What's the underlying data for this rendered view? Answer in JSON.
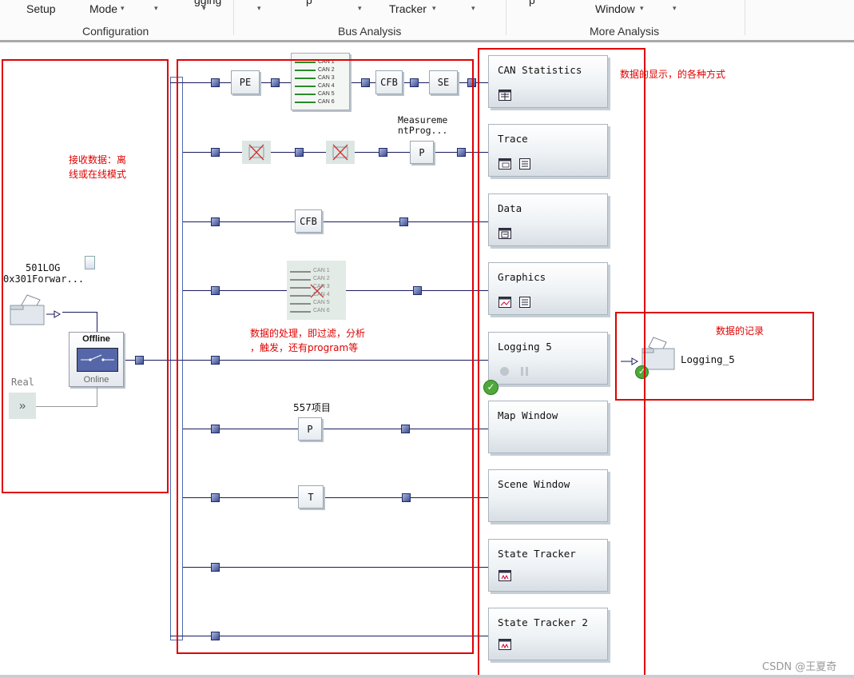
{
  "ribbon": {
    "items": [
      "Setup",
      "Mode",
      "Tracker",
      "Window"
    ],
    "groups": [
      "Configuration",
      "Bus Analysis",
      "More Analysis"
    ]
  },
  "annotations": {
    "receive": [
      "接收数据：离",
      "线或在线模式"
    ],
    "display": "数据的显示，的各种方式",
    "process": [
      "数据的处理，即过滤，分析",
      "，触发，还有program等"
    ],
    "logging": "数据的记录"
  },
  "source": {
    "log_name": "501LOG",
    "log_file": "0x301Forwar...",
    "offline": "Offline",
    "online": "Online",
    "real": "Real"
  },
  "processing": {
    "pe": "PE",
    "cfb": "CFB",
    "se": "SE",
    "p": "P",
    "t": "T",
    "measurement": [
      "Measureme",
      "ntProg..."
    ],
    "item557": "557项目",
    "can_channels": [
      "CAN 1",
      "CAN 2",
      "CAN 3",
      "CAN 4",
      "CAN 5",
      "CAN 6"
    ]
  },
  "windows": [
    "CAN Statistics",
    "Trace",
    "Data",
    "Graphics",
    "Logging 5",
    "Map Window",
    "Scene Window",
    "State Tracker",
    "State Tracker 2"
  ],
  "logging_block": "Logging_5",
  "watermark": "CSDN @王夏奇"
}
